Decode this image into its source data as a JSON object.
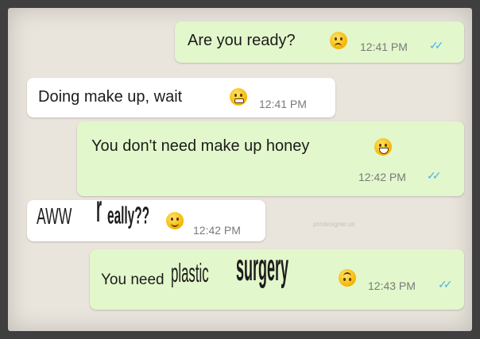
{
  "messages": [
    {
      "direction": "out",
      "text": "Are you ready?",
      "time": "12:41 PM",
      "emoji": "frowning-face-emoji",
      "ticks": "✓✓",
      "tick_color": "#4fb3e6"
    },
    {
      "direction": "in",
      "text": "Doing make up, wait",
      "time": "12:41 PM",
      "emoji": "grimacing-face-emoji"
    },
    {
      "direction": "out",
      "text": "You don't need make up honey",
      "time": "12:42 PM",
      "emoji": "grinning-face-emoji",
      "ticks": "✓✓",
      "tick_color": "#4fb3e6"
    },
    {
      "direction": "in",
      "text_parts": [
        "AWW",
        "r",
        "eally??"
      ],
      "time": "12:42 PM",
      "emoji": "smiling-face-emoji"
    },
    {
      "direction": "out",
      "text_parts": [
        "You need",
        "plastic",
        "surgery"
      ],
      "time": "12:43 PM",
      "emoji": "upside-down-face-emoji",
      "ticks": "✓✓",
      "tick_color": "#4fb3e6"
    }
  ],
  "watermark": "prodesigner.us",
  "colors": {
    "outgoing_bubble": "#e2f7cb",
    "incoming_bubble": "#ffffff",
    "background": "#e9e4dc",
    "frame": "#3f3f3f"
  }
}
